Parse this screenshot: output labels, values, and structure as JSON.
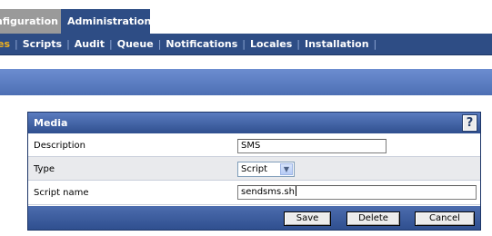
{
  "top_tabs": [
    {
      "label": "nfiguration",
      "active": false
    },
    {
      "label": "Administration",
      "active": true
    }
  ],
  "subnav": {
    "items": [
      {
        "label": "es",
        "active": true
      },
      {
        "label": "Scripts",
        "active": false
      },
      {
        "label": "Audit",
        "active": false
      },
      {
        "label": "Queue",
        "active": false
      },
      {
        "label": "Notifications",
        "active": false
      },
      {
        "label": "Locales",
        "active": false
      },
      {
        "label": "Installation",
        "active": false
      }
    ]
  },
  "panel": {
    "title": "Media",
    "help_label": "?",
    "fields": {
      "description": {
        "label": "Description",
        "value": "SMS"
      },
      "type": {
        "label": "Type",
        "value": "Script"
      },
      "script_name": {
        "label": "Script name",
        "value": "sendsms.sh"
      }
    },
    "buttons": {
      "save": "Save",
      "delete": "Delete",
      "cancel": "Cancel"
    }
  },
  "colors": {
    "nav_blue": "#2e4d85",
    "active_link": "#f2b21c",
    "inactive_tab": "#9a9a9a"
  }
}
